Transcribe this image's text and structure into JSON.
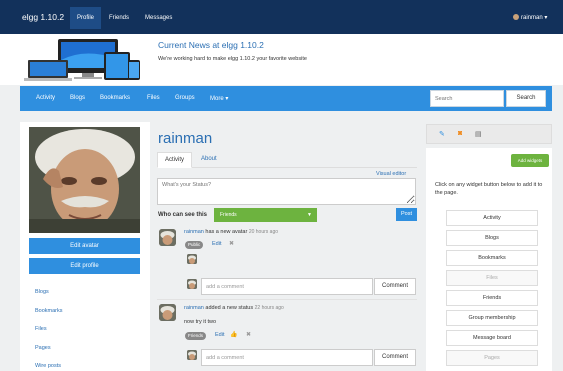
{
  "topbar": {
    "site_name": "elgg 1.10.2",
    "tabs": [
      "Profile",
      "Friends",
      "Messages"
    ],
    "user": "rainman"
  },
  "header": {
    "news_title": "Current News at elgg 1.10.2",
    "news_sub": "We're working hard to make elgg 1.10.2 your favorite website"
  },
  "nav": {
    "items": [
      "Activity",
      "Blogs",
      "Bookmarks",
      "Files",
      "Groups",
      "More"
    ],
    "search_placeholder": "Search",
    "search_button": "Search"
  },
  "sidebar": {
    "edit_avatar": "Edit avatar",
    "edit_profile": "Edit profile",
    "links": [
      "Blogs",
      "Bookmarks",
      "Files",
      "Pages",
      "Wire posts"
    ]
  },
  "profile": {
    "name": "rainman",
    "tabs": [
      "Activity",
      "About"
    ],
    "visual_editor": "Visual editor",
    "status_placeholder": "What's your Status?",
    "who_can_see": "Who can see this",
    "access_value": "Friends",
    "post_label": "Post"
  },
  "river": [
    {
      "user": "rainman",
      "action": " has a new avatar ",
      "time": "20 hours ago",
      "badge": "Public",
      "edit": "Edit",
      "comment_placeholder": "add a comment",
      "comment_button": "Comment"
    },
    {
      "user": "rainman",
      "action": " added a new status ",
      "time": "22 hours ago",
      "body": "now try it two",
      "badge": "Friends",
      "edit": "Edit",
      "comment_placeholder": "add a comment",
      "comment_button": "Comment"
    }
  ],
  "widgets": {
    "add_button": "Add widgets",
    "help": "Click on any widget button below to add it to the page.",
    "items": [
      {
        "label": "Activity",
        "disabled": false
      },
      {
        "label": "Blogs",
        "disabled": false
      },
      {
        "label": "Bookmarks",
        "disabled": false
      },
      {
        "label": "Files",
        "disabled": true
      },
      {
        "label": "Friends",
        "disabled": false
      },
      {
        "label": "Group membership",
        "disabled": false
      },
      {
        "label": "Message board",
        "disabled": false
      },
      {
        "label": "Pages",
        "disabled": true
      }
    ]
  },
  "colors": {
    "topbar": "#12315b",
    "nav": "#2f8fdf",
    "link": "#2b6fb3",
    "green": "#6db33f"
  }
}
